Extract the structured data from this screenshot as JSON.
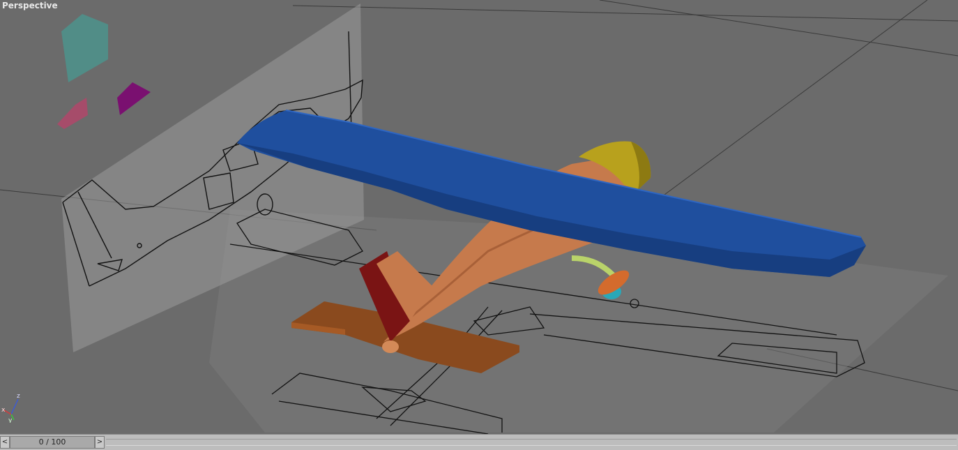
{
  "viewport": {
    "label": "Perspective"
  },
  "axis_gizmo": {
    "x": "x",
    "y": "y",
    "z": "z"
  },
  "timebar": {
    "frame_readout": "0 / 100",
    "prev_icon": "chevron-left-icon",
    "next_icon": "chevron-right-icon"
  },
  "colors": {
    "background": "#6b6b6b",
    "wing": "#1f4f9e",
    "fuselage": "#c67a4c",
    "tail_fin": "#7a1414",
    "stabilizer": "#8a4a1e",
    "nose_cowl": "#b8a11d",
    "spinner": "#d46b2d",
    "landing_gear": "#b9d36a",
    "wheel": "#2aa8b8",
    "gizmo_cyan": "#3fa39a",
    "gizmo_pink": "#b0466a",
    "gizmo_purple": "#7a1070"
  }
}
